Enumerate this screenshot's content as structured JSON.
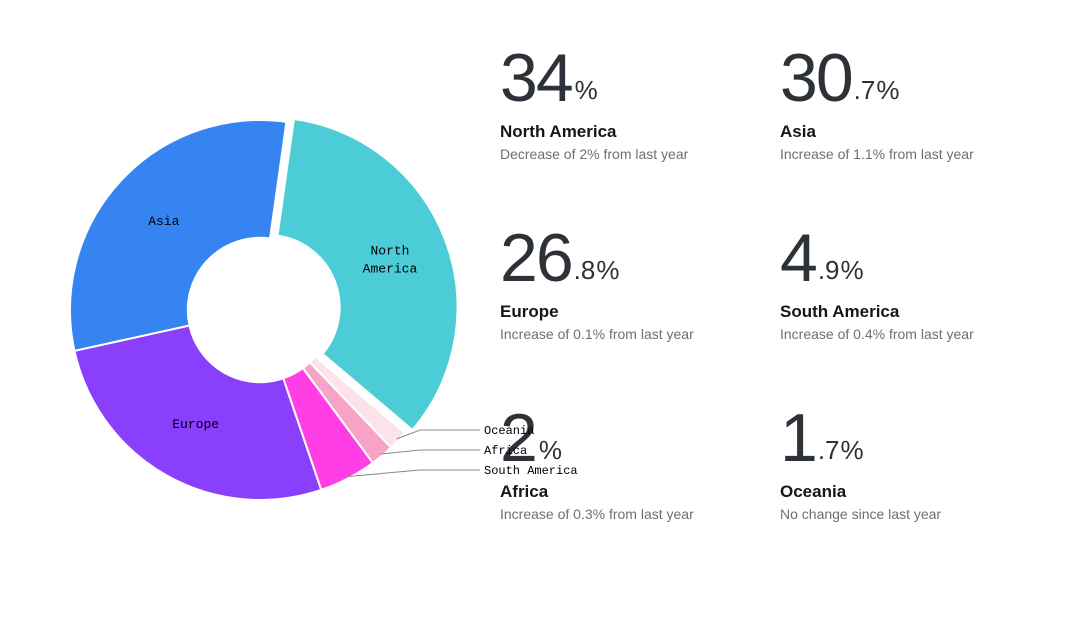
{
  "chart_data": {
    "type": "pie",
    "title": "",
    "series": [
      {
        "name": "North America",
        "value": 34.0,
        "color": "#4bccd7",
        "label": "North America"
      },
      {
        "name": "Asia",
        "value": 30.7,
        "color": "#3683f2",
        "label": "Asia"
      },
      {
        "name": "Europe",
        "value": 26.8,
        "color": "#8a3ffc",
        "label": "Europe"
      },
      {
        "name": "South America",
        "value": 4.9,
        "color": "#ff3ee6",
        "label": "South America"
      },
      {
        "name": "Africa",
        "value": 2.0,
        "color": "#f5a3c7",
        "label": "Africa"
      },
      {
        "name": "Oceania",
        "value": 1.7,
        "color": "#fde2e9",
        "label": "Oceania"
      }
    ],
    "donut_hole_ratio": 0.38
  },
  "stats": [
    {
      "int": "34",
      "dec": "",
      "label": "North America",
      "sub": "Decrease of 2% from last year"
    },
    {
      "int": "30",
      "dec": ".7",
      "label": "Asia",
      "sub": "Increase of 1.1% from last year"
    },
    {
      "int": "26",
      "dec": ".8",
      "label": "Europe",
      "sub": "Increase of 0.1% from last year"
    },
    {
      "int": "4",
      "dec": ".9",
      "label": "South America",
      "sub": "Increase of 0.4% from last year"
    },
    {
      "int": "2",
      "dec": "",
      "label": "Africa",
      "sub": "Increase of 0.3% from last year"
    },
    {
      "int": "1",
      "dec": ".7",
      "label": "Oceania",
      "sub": "No change since last year"
    }
  ],
  "pct_symbol": "%"
}
